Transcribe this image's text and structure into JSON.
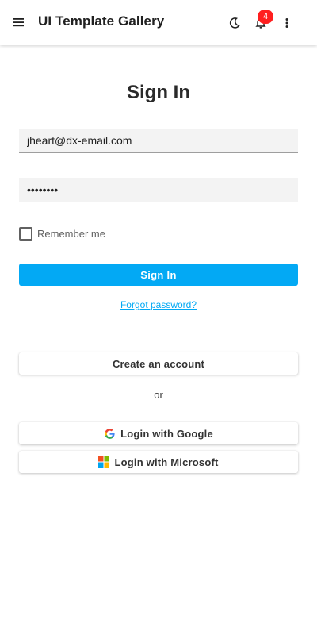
{
  "header": {
    "app_title": "UI Template Gallery",
    "notification_count": "4"
  },
  "signin": {
    "title": "Sign In",
    "email_value": "jheart@dx-email.com",
    "password_value": "••••••••",
    "remember_label": "Remember me",
    "remember_checked": false,
    "submit_label": "Sign In",
    "forgot_label": "Forgot password?",
    "create_label": "Create an account",
    "or_label": "or",
    "google_label": "Login with Google",
    "microsoft_label": "Login with Microsoft"
  },
  "colors": {
    "accent": "#03a9f4",
    "badge": "#ff1f1f"
  },
  "icons": [
    "menu-icon",
    "moon-icon",
    "bell-icon",
    "more-vert-icon",
    "google-icon",
    "microsoft-icon"
  ]
}
